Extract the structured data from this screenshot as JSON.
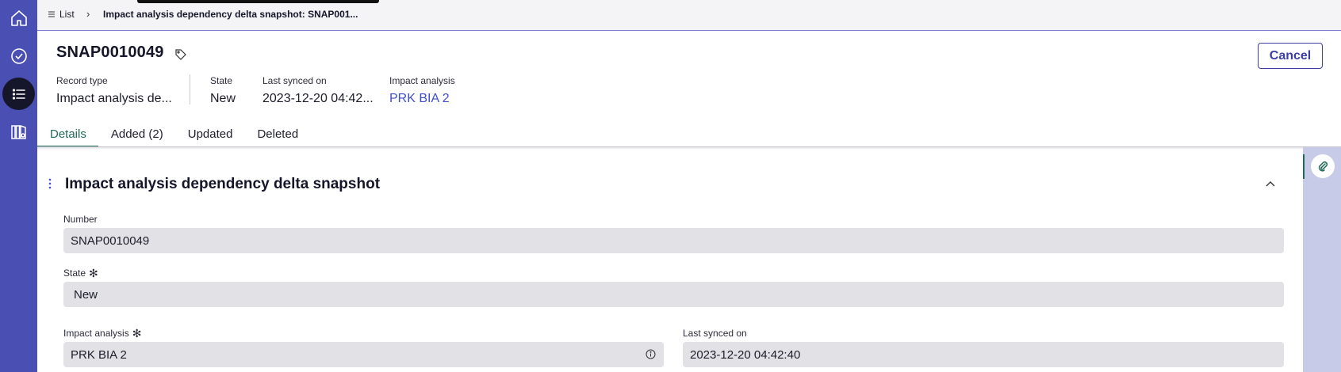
{
  "nav": {
    "items": [
      {
        "name": "home-icon"
      },
      {
        "name": "check-circle-icon"
      },
      {
        "name": "list-icon",
        "active": true
      },
      {
        "name": "workspace-icon"
      }
    ]
  },
  "breadcrumb": {
    "list_label": "List",
    "current": "Impact analysis dependency delta snapshot: SNAP001..."
  },
  "header": {
    "title": "SNAP0010049",
    "cancel_label": "Cancel",
    "meta": {
      "record_type_label": "Record type",
      "record_type_value": "Impact analysis de...",
      "state_label": "State",
      "state_value": "New",
      "last_synced_label": "Last synced on",
      "last_synced_value": "2023-12-20 04:42...",
      "impact_label": "Impact analysis",
      "impact_value": "PRK BIA 2"
    }
  },
  "tabs": [
    {
      "label": "Details",
      "active": true
    },
    {
      "label": "Added (2)"
    },
    {
      "label": "Updated"
    },
    {
      "label": "Deleted"
    }
  ],
  "section": {
    "title": "Impact analysis dependency delta snapshot"
  },
  "form": {
    "number_label": "Number",
    "number_value": "SNAP0010049",
    "state_label": "State",
    "state_value": "New",
    "impact_label": "Impact analysis",
    "impact_value": "PRK BIA 2",
    "last_synced_label": "Last synced on",
    "last_synced_value": "2023-12-20 04:42:40"
  },
  "colors": {
    "rail": "#4a4fb3",
    "accent": "#1f6b55",
    "link": "#3f4fc9",
    "field_bg": "#e1e1e6"
  }
}
